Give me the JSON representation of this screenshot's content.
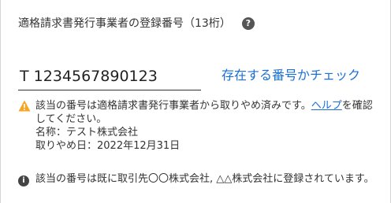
{
  "field": {
    "label": "適格請求書発行事業者の登録番号（13桁）",
    "help_icon": "question-circle-icon",
    "value": "T 1234567890123",
    "check_link": "存在する番号かチェック"
  },
  "warning": {
    "icon": "warning-triangle-icon",
    "icon_color": "#f5a623",
    "text_before": "該当の番号は適格請求書発行事業者から取りやめ済みです。",
    "link_text": "ヘルプ",
    "text_after": "を確認してください。",
    "name_line": "名称：テスト株式会社",
    "date_line": "取りやめ日：2022年12月31日"
  },
  "info": {
    "icon": "info-circle-icon",
    "text": "該当の番号は既に取引先〇〇株式会社, △△株式会社に登録されています。"
  },
  "colors": {
    "link": "#1a6fd4",
    "text": "#333333"
  }
}
